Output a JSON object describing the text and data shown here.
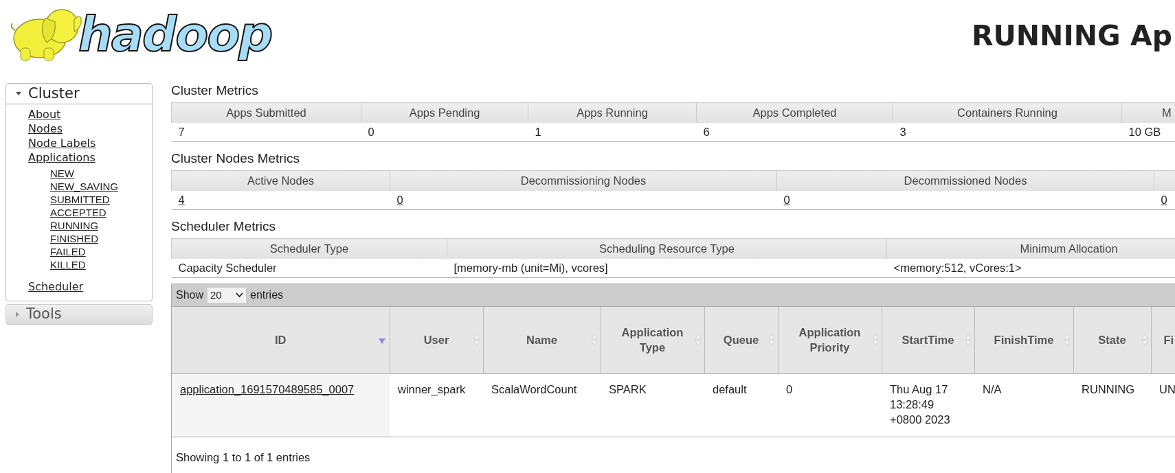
{
  "logo": {
    "text": "hadoop"
  },
  "title": "RUNNING Ap",
  "sidebar": [
    {
      "label": "Cluster",
      "expanded": true,
      "items": [
        {
          "label": "About"
        },
        {
          "label": "Nodes"
        },
        {
          "label": "Node Labels"
        },
        {
          "label": "Applications",
          "children": [
            {
              "label": "NEW"
            },
            {
              "label": "NEW_SAVING"
            },
            {
              "label": "SUBMITTED"
            },
            {
              "label": "ACCEPTED"
            },
            {
              "label": "RUNNING"
            },
            {
              "label": "FINISHED"
            },
            {
              "label": "FAILED"
            },
            {
              "label": "KILLED"
            }
          ]
        },
        {
          "label": "Scheduler"
        }
      ]
    },
    {
      "label": "Tools",
      "expanded": false
    }
  ],
  "metrics": [
    {
      "title": "Cluster Metrics",
      "links": false,
      "columns": [
        "Apps Submitted",
        "Apps Pending",
        "Apps Running",
        "Apps Completed",
        "Containers Running",
        "M"
      ],
      "values": [
        "7",
        "0",
        "1",
        "6",
        "3",
        "10 GB"
      ]
    },
    {
      "title": "Cluster Nodes Metrics",
      "links": true,
      "columns": [
        "Active Nodes",
        "Decommissioning Nodes",
        "Decommissioned Nodes",
        null
      ],
      "values": [
        "4",
        "0",
        "0",
        "0"
      ]
    },
    {
      "title": "Scheduler Metrics",
      "links": false,
      "columns": [
        "Scheduler Type",
        "Scheduling Resource Type",
        "Minimum Allocation"
      ],
      "values": [
        "Capacity Scheduler",
        "[memory-mb (unit=Mi), vcores]",
        "<memory:512, vCores:1>"
      ]
    }
  ],
  "apps_table": {
    "length_prefix": "Show",
    "length_value": "20",
    "length_suffix": "entries",
    "columns": [
      {
        "label": "ID",
        "sorted": true
      },
      {
        "label": "User",
        "sorted": false
      },
      {
        "label": "Name",
        "sorted": false
      },
      {
        "label": "Application Type",
        "sorted": false
      },
      {
        "label": "Queue",
        "sorted": false
      },
      {
        "label": "Application Priority",
        "sorted": false
      },
      {
        "label": "StartTime",
        "sorted": false
      },
      {
        "label": "FinishTime",
        "sorted": false
      },
      {
        "label": "State",
        "sorted": false
      },
      {
        "label": "Fi"
      }
    ],
    "rows": [
      {
        "cells": [
          "application_1691570489585_0007",
          "winner_spark",
          "ScalaWordCount",
          "SPARK",
          "default",
          "0",
          "Thu Aug 17 13:28:49 +0800 2023",
          "N/A",
          "RUNNING",
          "UN"
        ]
      }
    ],
    "info": "Showing 1 to 1 of 1 entries"
  }
}
